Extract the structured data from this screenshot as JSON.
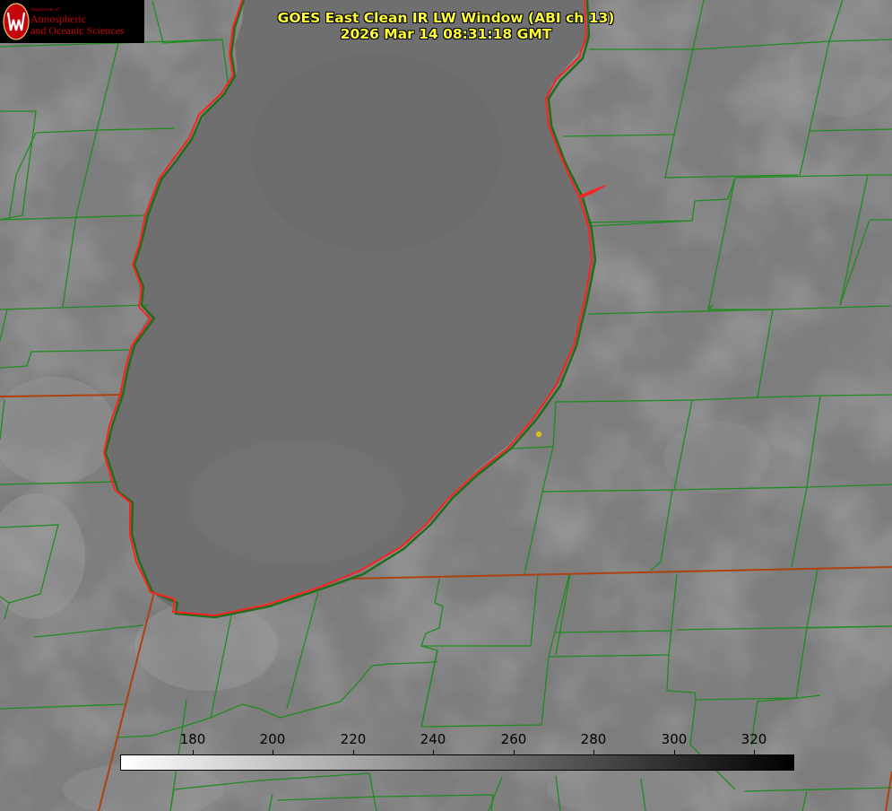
{
  "title": {
    "line1": "GOES East Clean IR LW Window (ABI ch 13)",
    "line2": "2026 Mar 14 08:31:18 GMT"
  },
  "logo": {
    "dept": "Department of",
    "name_line1": "Atmospheric",
    "name_line2": "and Oceanic Sciences",
    "brand_color": "#c5050c"
  },
  "colorbar": {
    "ticks": [
      "180",
      "200",
      "220",
      "240",
      "260",
      "280",
      "300",
      "320"
    ],
    "min": 162,
    "max": 330,
    "colormap": "white-to-black",
    "tick_values": [
      180,
      200,
      220,
      240,
      260,
      280,
      300,
      320
    ]
  },
  "colors": {
    "county_lines": "#1e8c1e",
    "lake_shoreline": "#ff2020",
    "state_lines": "#b04010",
    "marker": "#d8c020",
    "title_text": "#ffff33"
  },
  "map": {
    "features": [
      "lake-michigan-shoreline",
      "county-boundaries",
      "state-boundaries",
      "station-marker"
    ]
  }
}
